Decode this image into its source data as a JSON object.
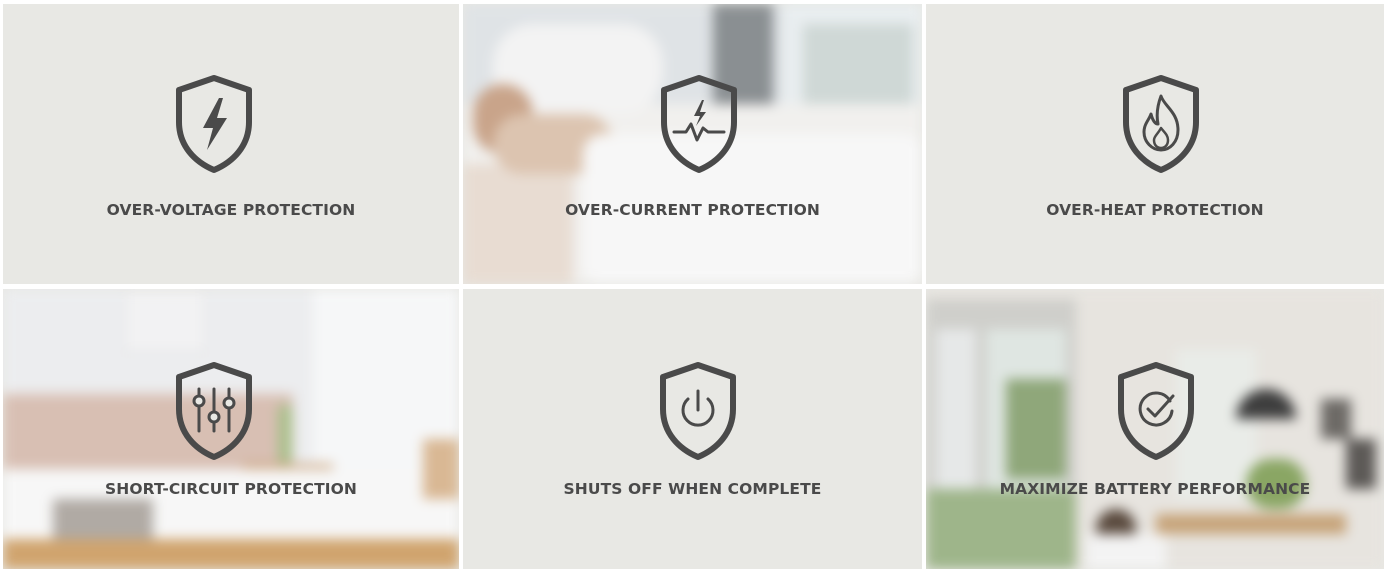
{
  "features": [
    {
      "label": "OVER-VOLTAGE PROTECTION",
      "icon": "lightning-shield-icon"
    },
    {
      "label": "OVER-CURRENT PROTECTION",
      "icon": "current-pulse-shield-icon"
    },
    {
      "label": "OVER-HEAT PROTECTION",
      "icon": "flame-shield-icon"
    },
    {
      "label": "SHORT-CIRCUIT PROTECTION",
      "icon": "sliders-shield-icon"
    },
    {
      "label": "SHUTS OFF WHEN COMPLETE",
      "icon": "power-shield-icon"
    },
    {
      "label": "MAXIMIZE BATTERY PERFORMANCE",
      "icon": "check-shield-icon"
    }
  ],
  "colors": {
    "tile_background": "#e8e8e4",
    "icon_stroke": "#4a4a4a",
    "label_text": "#4a4a4a"
  }
}
